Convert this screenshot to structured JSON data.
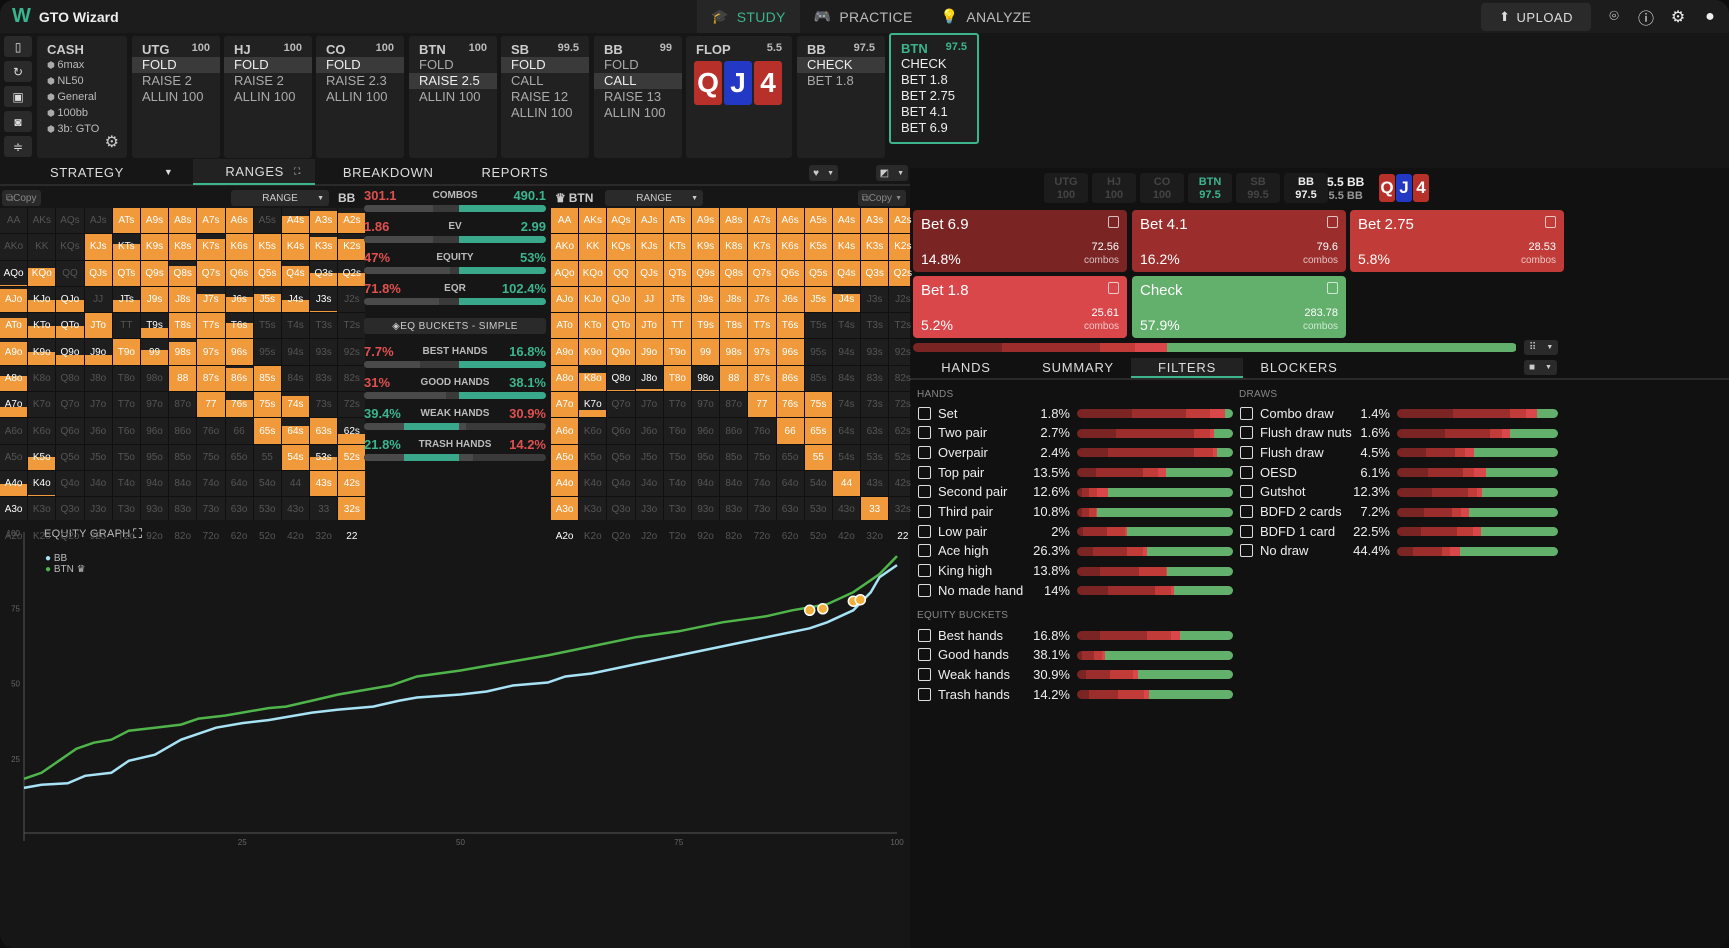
{
  "app": {
    "title": "GTO Wizard",
    "logo": "W"
  },
  "nav": [
    {
      "label": "STUDY",
      "icon": "graduation-cap-icon",
      "active": true
    },
    {
      "label": "PRACTICE",
      "icon": "gamepad-icon",
      "active": false
    },
    {
      "label": "ANALYZE",
      "icon": "lightbulb-icon",
      "active": false
    }
  ],
  "topright": {
    "upload": "UPLOAD"
  },
  "cash": {
    "title": "CASH",
    "items": [
      "6max",
      "NL50",
      "General",
      "100bb",
      "3b: GTO"
    ]
  },
  "positions": [
    {
      "name": "UTG",
      "stack": "100",
      "actions": [
        "FOLD",
        "RAISE 2",
        "ALLIN 100"
      ],
      "selected": 0
    },
    {
      "name": "HJ",
      "stack": "100",
      "actions": [
        "FOLD",
        "RAISE 2",
        "ALLIN 100"
      ],
      "selected": 0
    },
    {
      "name": "CO",
      "stack": "100",
      "actions": [
        "FOLD",
        "RAISE 2.3",
        "ALLIN 100"
      ],
      "selected": 0
    },
    {
      "name": "BTN",
      "stack": "100",
      "actions": [
        "FOLD",
        "RAISE 2.5",
        "ALLIN 100"
      ],
      "selected": 1
    },
    {
      "name": "SB",
      "stack": "99.5",
      "actions": [
        "FOLD",
        "CALL",
        "RAISE 12",
        "ALLIN 100"
      ],
      "selected": 0
    },
    {
      "name": "BB",
      "stack": "99",
      "actions": [
        "FOLD",
        "CALL",
        "RAISE 13",
        "ALLIN 100"
      ],
      "selected": 1
    }
  ],
  "flop": {
    "label": "FLOP",
    "pot": "5.5",
    "cards": [
      {
        "rank": "Q",
        "suit": "heart"
      },
      {
        "rank": "J",
        "suit": "diam"
      },
      {
        "rank": "4",
        "suit": "heart"
      }
    ]
  },
  "bbnode": {
    "name": "BB",
    "stack": "97.5",
    "actions": [
      "CHECK",
      "BET 1.8"
    ],
    "selected": 0
  },
  "btnnode": {
    "name": "BTN",
    "stack": "97.5",
    "actions": [
      "CHECK",
      "BET 1.8",
      "BET 2.75",
      "BET 4.1",
      "BET 6.9"
    ]
  },
  "tabs": {
    "strategy": "STRATEGY",
    "ranges": "RANGES",
    "breakdown": "BREAKDOWN",
    "reports": "REPORTS"
  },
  "leftgrid": {
    "copy": "Copy",
    "range": "RANGE",
    "player": "BB"
  },
  "rightgrid": {
    "copy": "Copy",
    "range": "RANGE",
    "player": "BTN"
  },
  "stats": [
    {
      "label": "COMBOS",
      "left": "301.1",
      "right": "490.1",
      "leftColor": "red",
      "rightColor": "green",
      "leftFrac": 0.38
    },
    {
      "label": "EV",
      "left": "1.86",
      "right": "2.99",
      "leftColor": "red",
      "rightColor": "green",
      "leftFrac": 0.38
    },
    {
      "label": "EQUITY",
      "left": "47%",
      "right": "53%",
      "leftColor": "red",
      "rightColor": "green",
      "leftFrac": 0.47
    },
    {
      "label": "EQR",
      "left": "71.8%",
      "right": "102.4%",
      "leftColor": "red",
      "rightColor": "green",
      "leftFrac": 0.41
    }
  ],
  "eqbuckets": {
    "label": "EQ BUCKETS - SIMPLE",
    "rows": [
      {
        "label": "BEST HANDS",
        "left": "7.7%",
        "right": "16.8%",
        "leftColor": "red",
        "rightColor": "green",
        "leftFrac": 0.31
      },
      {
        "label": "GOOD HANDS",
        "left": "31%",
        "right": "38.1%",
        "leftColor": "red",
        "rightColor": "green",
        "leftFrac": 0.45
      },
      {
        "label": "WEAK HANDS",
        "left": "39.4%",
        "right": "30.9%",
        "leftColor": "green",
        "rightColor": "red",
        "leftFrac": 0.56
      },
      {
        "label": "TRASH HANDS",
        "left": "21.8%",
        "right": "14.2%",
        "leftColor": "green",
        "rightColor": "red",
        "leftFrac": 0.6
      }
    ]
  },
  "hands_labels": [
    "AA",
    "AKs",
    "AQs",
    "AJs",
    "ATs",
    "A9s",
    "A8s",
    "A7s",
    "A6s",
    "A5s",
    "A4s",
    "A3s",
    "A2s",
    "AKo",
    "KK",
    "KQs",
    "KJs",
    "KTs",
    "K9s",
    "K8s",
    "K7s",
    "K6s",
    "K5s",
    "K4s",
    "K3s",
    "K2s",
    "AQo",
    "KQo",
    "QQ",
    "QJs",
    "QTs",
    "Q9s",
    "Q8s",
    "Q7s",
    "Q6s",
    "Q5s",
    "Q4s",
    "Q3s",
    "Q2s",
    "AJo",
    "KJo",
    "QJo",
    "JJ",
    "JTs",
    "J9s",
    "J8s",
    "J7s",
    "J6s",
    "J5s",
    "J4s",
    "J3s",
    "J2s",
    "ATo",
    "KTo",
    "QTo",
    "JTo",
    "TT",
    "T9s",
    "T8s",
    "T7s",
    "T6s",
    "T5s",
    "T4s",
    "T3s",
    "T2s",
    "A9o",
    "K9o",
    "Q9o",
    "J9o",
    "T9o",
    "99",
    "98s",
    "97s",
    "96s",
    "95s",
    "94s",
    "93s",
    "92s",
    "A8o",
    "K8o",
    "Q8o",
    "J8o",
    "T8o",
    "98o",
    "88",
    "87s",
    "86s",
    "85s",
    "84s",
    "83s",
    "82s",
    "A7o",
    "K7o",
    "Q7o",
    "J7o",
    "T7o",
    "97o",
    "87o",
    "77",
    "76s",
    "75s",
    "74s",
    "73s",
    "72s",
    "A6o",
    "K6o",
    "Q6o",
    "J6o",
    "T6o",
    "96o",
    "86o",
    "76o",
    "66",
    "65s",
    "64s",
    "63s",
    "62s",
    "A5o",
    "K5o",
    "Q5o",
    "J5o",
    "T5o",
    "95o",
    "85o",
    "75o",
    "65o",
    "55",
    "54s",
    "53s",
    "52s",
    "A4o",
    "K4o",
    "Q4o",
    "J4o",
    "T4o",
    "94o",
    "84o",
    "74o",
    "64o",
    "54o",
    "44",
    "43s",
    "42s",
    "A3o",
    "K3o",
    "Q3o",
    "J3o",
    "T3o",
    "93o",
    "83o",
    "73o",
    "63o",
    "53o",
    "43o",
    "33",
    "32s",
    "A2o",
    "K2o",
    "Q2o",
    "J2o",
    "T2o",
    "92o",
    "82o",
    "72o",
    "62o",
    "52o",
    "42o",
    "32o",
    "22"
  ],
  "bb_freq": [
    0,
    0,
    0,
    0,
    1,
    1,
    1,
    1,
    1,
    0,
    0.7,
    0.9,
    0.8,
    0,
    0,
    0,
    1,
    0.6,
    1,
    1,
    0.8,
    1,
    1,
    1,
    0.9,
    0.8,
    0.05,
    0.7,
    0,
    1,
    1,
    1,
    0.8,
    1,
    1,
    1,
    0.8,
    0.5,
    0.5,
    0.9,
    0.5,
    0.5,
    0,
    0.5,
    1,
    1,
    0.7,
    0.6,
    0.7,
    0.5,
    0.05,
    0,
    0.8,
    0.5,
    0.5,
    1,
    0,
    0.4,
    1,
    1,
    0.6,
    0,
    0,
    0,
    0,
    0.9,
    0.5,
    0.4,
    0.4,
    1,
    0.6,
    0.9,
    1,
    1,
    0,
    0,
    0,
    0,
    0.6,
    0,
    0,
    0,
    0,
    0,
    1,
    1,
    0.9,
    1,
    0,
    0,
    0,
    0.4,
    0,
    0,
    0,
    0,
    0,
    0,
    1,
    0.7,
    1,
    0.85,
    0,
    0,
    0,
    0,
    0,
    0,
    0,
    0,
    0,
    0,
    0,
    1,
    0.7,
    1,
    0.4,
    0,
    0.5,
    0,
    0,
    0,
    0,
    0,
    0,
    0,
    0,
    1,
    0.5,
    1,
    0.5,
    0.05,
    0,
    0,
    0,
    0,
    0,
    0,
    0,
    0,
    0,
    1,
    1,
    0.05,
    0,
    0,
    0,
    0,
    0,
    0,
    0,
    0,
    0,
    0,
    0,
    1,
    0,
    0,
    0,
    0,
    0,
    0,
    0,
    0,
    0,
    0,
    0,
    0,
    1
  ],
  "btn_freq": [
    1,
    1,
    1,
    1,
    1,
    1,
    1,
    1,
    1,
    1,
    1,
    1,
    1,
    1,
    1,
    1,
    1,
    1,
    1,
    1,
    1,
    1,
    1,
    1,
    1,
    1,
    1,
    1,
    1,
    1,
    1,
    1,
    1,
    1,
    1,
    1,
    1,
    1,
    1,
    1,
    1,
    1,
    1,
    1,
    1,
    1,
    1,
    1,
    1,
    0.7,
    0,
    0,
    1,
    1,
    1,
    1,
    1,
    1,
    1,
    1,
    1,
    0,
    0,
    0,
    0,
    1,
    1,
    1,
    1,
    1,
    1,
    1,
    1,
    1,
    0,
    0,
    0,
    0,
    1,
    0.7,
    0.05,
    0.1,
    1,
    0.05,
    1,
    1,
    1,
    0,
    0,
    0,
    0,
    1,
    0.3,
    0,
    0,
    0,
    0,
    0,
    1,
    1,
    1,
    0,
    0,
    0,
    1,
    0,
    0,
    0,
    0,
    0,
    0,
    0,
    1,
    1,
    0,
    0,
    0,
    1,
    0,
    0,
    0,
    0,
    0,
    0,
    0,
    0,
    1,
    0,
    0,
    0,
    1,
    0,
    0,
    0,
    0,
    0,
    0,
    0,
    0,
    0,
    1,
    0,
    0,
    1,
    0,
    0,
    0,
    0,
    0,
    0,
    0,
    0,
    0,
    0,
    1,
    0,
    1,
    0,
    0,
    0,
    0,
    0,
    0,
    0,
    0,
    0,
    0,
    0,
    1
  ],
  "seats": [
    {
      "name": "UTG",
      "stack": "100"
    },
    {
      "name": "HJ",
      "stack": "100"
    },
    {
      "name": "CO",
      "stack": "100"
    },
    {
      "name": "BTN",
      "stack": "97.5"
    },
    {
      "name": "SB",
      "stack": "99.5"
    },
    {
      "name": "BB",
      "stack": "97.5"
    }
  ],
  "pot": {
    "main": "5.5 BB",
    "sub": "5.5 BB"
  },
  "actions": [
    {
      "label": "Bet 6.9",
      "pct": "14.8%",
      "combos": "72.56",
      "color": "#7a2424"
    },
    {
      "label": "Bet 4.1",
      "pct": "16.2%",
      "combos": "79.6",
      "color": "#9b2e2c"
    },
    {
      "label": "Bet 2.75",
      "pct": "5.8%",
      "combos": "28.53",
      "color": "#c13c38"
    },
    {
      "label": "Bet 1.8",
      "pct": "5.2%",
      "combos": "25.61",
      "color": "#d9474a"
    },
    {
      "label": "Check",
      "pct": "57.9%",
      "combos": "283.78",
      "color": "#62b06b"
    }
  ],
  "combos_word": "combos",
  "rtabs": [
    "HANDS",
    "SUMMARY",
    "FILTERS",
    "BLOCKERS"
  ],
  "filters": {
    "hands_title": "HANDS",
    "hands": [
      {
        "label": "Set",
        "pct": "1.8%",
        "mix": [
          0.35,
          0.35,
          0.15,
          0.1,
          0.05
        ]
      },
      {
        "label": "Two pair",
        "pct": "2.7%",
        "mix": [
          0.25,
          0.5,
          0.1,
          0.03,
          0.12
        ]
      },
      {
        "label": "Overpair",
        "pct": "2.4%",
        "mix": [
          0.2,
          0.55,
          0.12,
          0.03,
          0.1
        ]
      },
      {
        "label": "Top pair",
        "pct": "13.5%",
        "mix": [
          0.12,
          0.3,
          0.1,
          0.05,
          0.43
        ]
      },
      {
        "label": "Second pair",
        "pct": "12.6%",
        "mix": [
          0.03,
          0.05,
          0.05,
          0.07,
          0.8
        ]
      },
      {
        "label": "Third pair",
        "pct": "10.8%",
        "mix": [
          0.03,
          0.05,
          0.04,
          0.01,
          0.87
        ]
      },
      {
        "label": "Low pair",
        "pct": "2%",
        "mix": [
          0.04,
          0.15,
          0.12,
          0.01,
          0.68
        ]
      },
      {
        "label": "Ace high",
        "pct": "26.3%",
        "mix": [
          0.1,
          0.22,
          0.1,
          0.03,
          0.55
        ]
      },
      {
        "label": "King high",
        "pct": "13.8%",
        "mix": [
          0.15,
          0.25,
          0.17,
          0.01,
          0.42
        ]
      },
      {
        "label": "No made hand",
        "pct": "14%",
        "mix": [
          0.2,
          0.3,
          0.1,
          0.02,
          0.38
        ]
      }
    ],
    "eq_title": "EQUITY BUCKETS",
    "eq": [
      {
        "label": "Best hands",
        "pct": "16.8%",
        "mix": [
          0.15,
          0.3,
          0.15,
          0.06,
          0.34
        ]
      },
      {
        "label": "Good hands",
        "pct": "38.1%",
        "mix": [
          0.03,
          0.08,
          0.05,
          0.02,
          0.82
        ]
      },
      {
        "label": "Weak hands",
        "pct": "30.9%",
        "mix": [
          0.06,
          0.15,
          0.15,
          0.03,
          0.61
        ]
      },
      {
        "label": "Trash hands",
        "pct": "14.2%",
        "mix": [
          0.08,
          0.18,
          0.17,
          0.03,
          0.54
        ]
      }
    ],
    "draws_title": "DRAWS",
    "draws": [
      {
        "label": "Combo draw",
        "pct": "1.4%",
        "mix": [
          0.35,
          0.35,
          0.1,
          0.07,
          0.13
        ]
      },
      {
        "label": "Flush draw nuts",
        "pct": "1.6%",
        "mix": [
          0.3,
          0.28,
          0.07,
          0.05,
          0.3
        ]
      },
      {
        "label": "Flush draw",
        "pct": "4.5%",
        "mix": [
          0.18,
          0.18,
          0.06,
          0.06,
          0.52
        ]
      },
      {
        "label": "OESD",
        "pct": "6.1%",
        "mix": [
          0.19,
          0.22,
          0.07,
          0.07,
          0.45
        ]
      },
      {
        "label": "Gutshot",
        "pct": "12.3%",
        "mix": [
          0.22,
          0.22,
          0.06,
          0.03,
          0.47
        ]
      },
      {
        "label": "BDFD 2 cards",
        "pct": "7.2%",
        "mix": [
          0.17,
          0.17,
          0.06,
          0.05,
          0.55
        ]
      },
      {
        "label": "BDFD 1 card",
        "pct": "22.5%",
        "mix": [
          0.15,
          0.22,
          0.1,
          0.05,
          0.48
        ]
      },
      {
        "label": "No draw",
        "pct": "44.4%",
        "mix": [
          0.1,
          0.18,
          0.05,
          0.06,
          0.61
        ]
      }
    ]
  },
  "chart_data": {
    "type": "line",
    "title": "EQUITY GRAPH",
    "xlabel": "",
    "ylabel": "",
    "xlim": [
      0,
      100
    ],
    "ylim": [
      0,
      100
    ],
    "xticks": [
      25,
      50,
      75,
      100
    ],
    "yticks": [
      25,
      50,
      75,
      100
    ],
    "legend": "top-left",
    "series": [
      {
        "name": "BB",
        "color": "#a7e3f5",
        "x": [
          0,
          2,
          5,
          7,
          10,
          12,
          15,
          18,
          20,
          22,
          25,
          28,
          30,
          33,
          36,
          40,
          43,
          45,
          50,
          53,
          56,
          60,
          62,
          65,
          70,
          75,
          80,
          85,
          90,
          92,
          95,
          97,
          98,
          100
        ],
        "y": [
          15,
          16,
          16.5,
          19,
          20,
          24,
          26,
          31,
          33,
          35,
          36.5,
          37.5,
          38.5,
          40,
          41,
          42,
          44,
          45,
          46,
          47,
          49,
          50,
          52,
          53,
          56,
          59,
          62,
          65,
          68,
          70,
          74,
          80,
          85,
          89
        ]
      },
      {
        "name": "BTN",
        "color": "#4fb54a",
        "x": [
          0,
          2,
          4,
          6,
          8,
          10,
          12,
          15,
          18,
          20,
          23,
          25,
          28,
          30,
          33,
          36,
          40,
          42,
          45,
          50,
          53,
          56,
          60,
          65,
          70,
          75,
          80,
          85,
          88,
          90,
          92,
          95,
          97,
          98,
          100
        ],
        "y": [
          18,
          20,
          24,
          28,
          30,
          31,
          34,
          35,
          36,
          38,
          39,
          40,
          41.5,
          42,
          44,
          46,
          48,
          49,
          52,
          54,
          55.5,
          57,
          59,
          62,
          65,
          67,
          70,
          72,
          74,
          75,
          76,
          80,
          84,
          86,
          92
        ]
      }
    ],
    "markers": [
      {
        "x": 90,
        "y": 74
      },
      {
        "x": 91.5,
        "y": 74.5
      },
      {
        "x": 95,
        "y": 77
      },
      {
        "x": 95.8,
        "y": 77.5
      }
    ]
  }
}
